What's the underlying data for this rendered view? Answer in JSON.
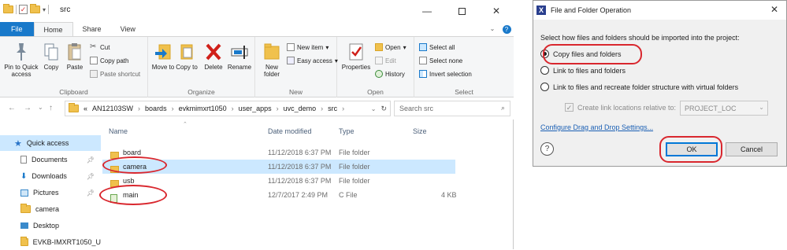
{
  "explorer": {
    "title": "src",
    "tabs": [
      "File",
      "Home",
      "Share",
      "View"
    ],
    "ribbon": {
      "clipboard": {
        "label": "Clipboard",
        "pin": "Pin to Quick access",
        "copy": "Copy",
        "paste": "Paste",
        "cut": "Cut",
        "copy_path": "Copy path",
        "paste_shortcut": "Paste shortcut"
      },
      "organize": {
        "label": "Organize",
        "move_to": "Move to",
        "copy_to": "Copy to",
        "delete": "Delete",
        "rename": "Rename"
      },
      "new": {
        "label": "New",
        "new_folder": "New folder",
        "new_item": "New item",
        "easy_access": "Easy access"
      },
      "open": {
        "label": "Open",
        "properties": "Properties",
        "open": "Open",
        "edit": "Edit",
        "history": "History"
      },
      "select": {
        "label": "Select",
        "select_all": "Select all",
        "select_none": "Select none",
        "invert": "Invert selection"
      }
    },
    "address": {
      "overflow": "«",
      "crumbs": [
        "AN12103SW",
        "boards",
        "evkmimxrt1050",
        "user_apps",
        "uvc_demo",
        "src"
      ]
    },
    "search_placeholder": "Search src",
    "nav": [
      {
        "label": "Quick access",
        "pinned": false
      },
      {
        "label": "Documents",
        "pinned": true
      },
      {
        "label": "Downloads",
        "pinned": true
      },
      {
        "label": "Pictures",
        "pinned": true
      },
      {
        "label": "camera",
        "pinned": false
      },
      {
        "label": "Desktop",
        "pinned": false
      },
      {
        "label": "EVKB-IMXRT1050_U",
        "pinned": false
      }
    ],
    "columns": {
      "name": "Name",
      "date": "Date modified",
      "type": "Type",
      "size": "Size"
    },
    "files": [
      {
        "name": "board",
        "date": "11/12/2018 6:37 PM",
        "type": "File folder",
        "size": ""
      },
      {
        "name": "camera",
        "date": "11/12/2018 6:37 PM",
        "type": "File folder",
        "size": ""
      },
      {
        "name": "usb",
        "date": "11/12/2018 6:37 PM",
        "type": "File folder",
        "size": ""
      },
      {
        "name": "main",
        "date": "12/7/2017 2:49 PM",
        "type": "C File",
        "size": "4 KB"
      }
    ]
  },
  "dialog": {
    "title": "File and Folder Operation",
    "prompt": "Select how files and folders should be imported into the project:",
    "options": [
      "Copy files and folders",
      "Link to files and folders",
      "Link to files and recreate folder structure with virtual folders"
    ],
    "selected_index": 0,
    "checkbox_label": "Create link locations relative to:",
    "combo_value": "PROJECT_LOC",
    "link": "Configure Drag and Drop Settings...",
    "help": "?",
    "ok": "OK",
    "cancel": "Cancel"
  },
  "colors": {
    "accent": "#1979ca",
    "selection": "#cce8ff",
    "highlight_oval": "#d9272e",
    "folder": "#f0c14d"
  }
}
